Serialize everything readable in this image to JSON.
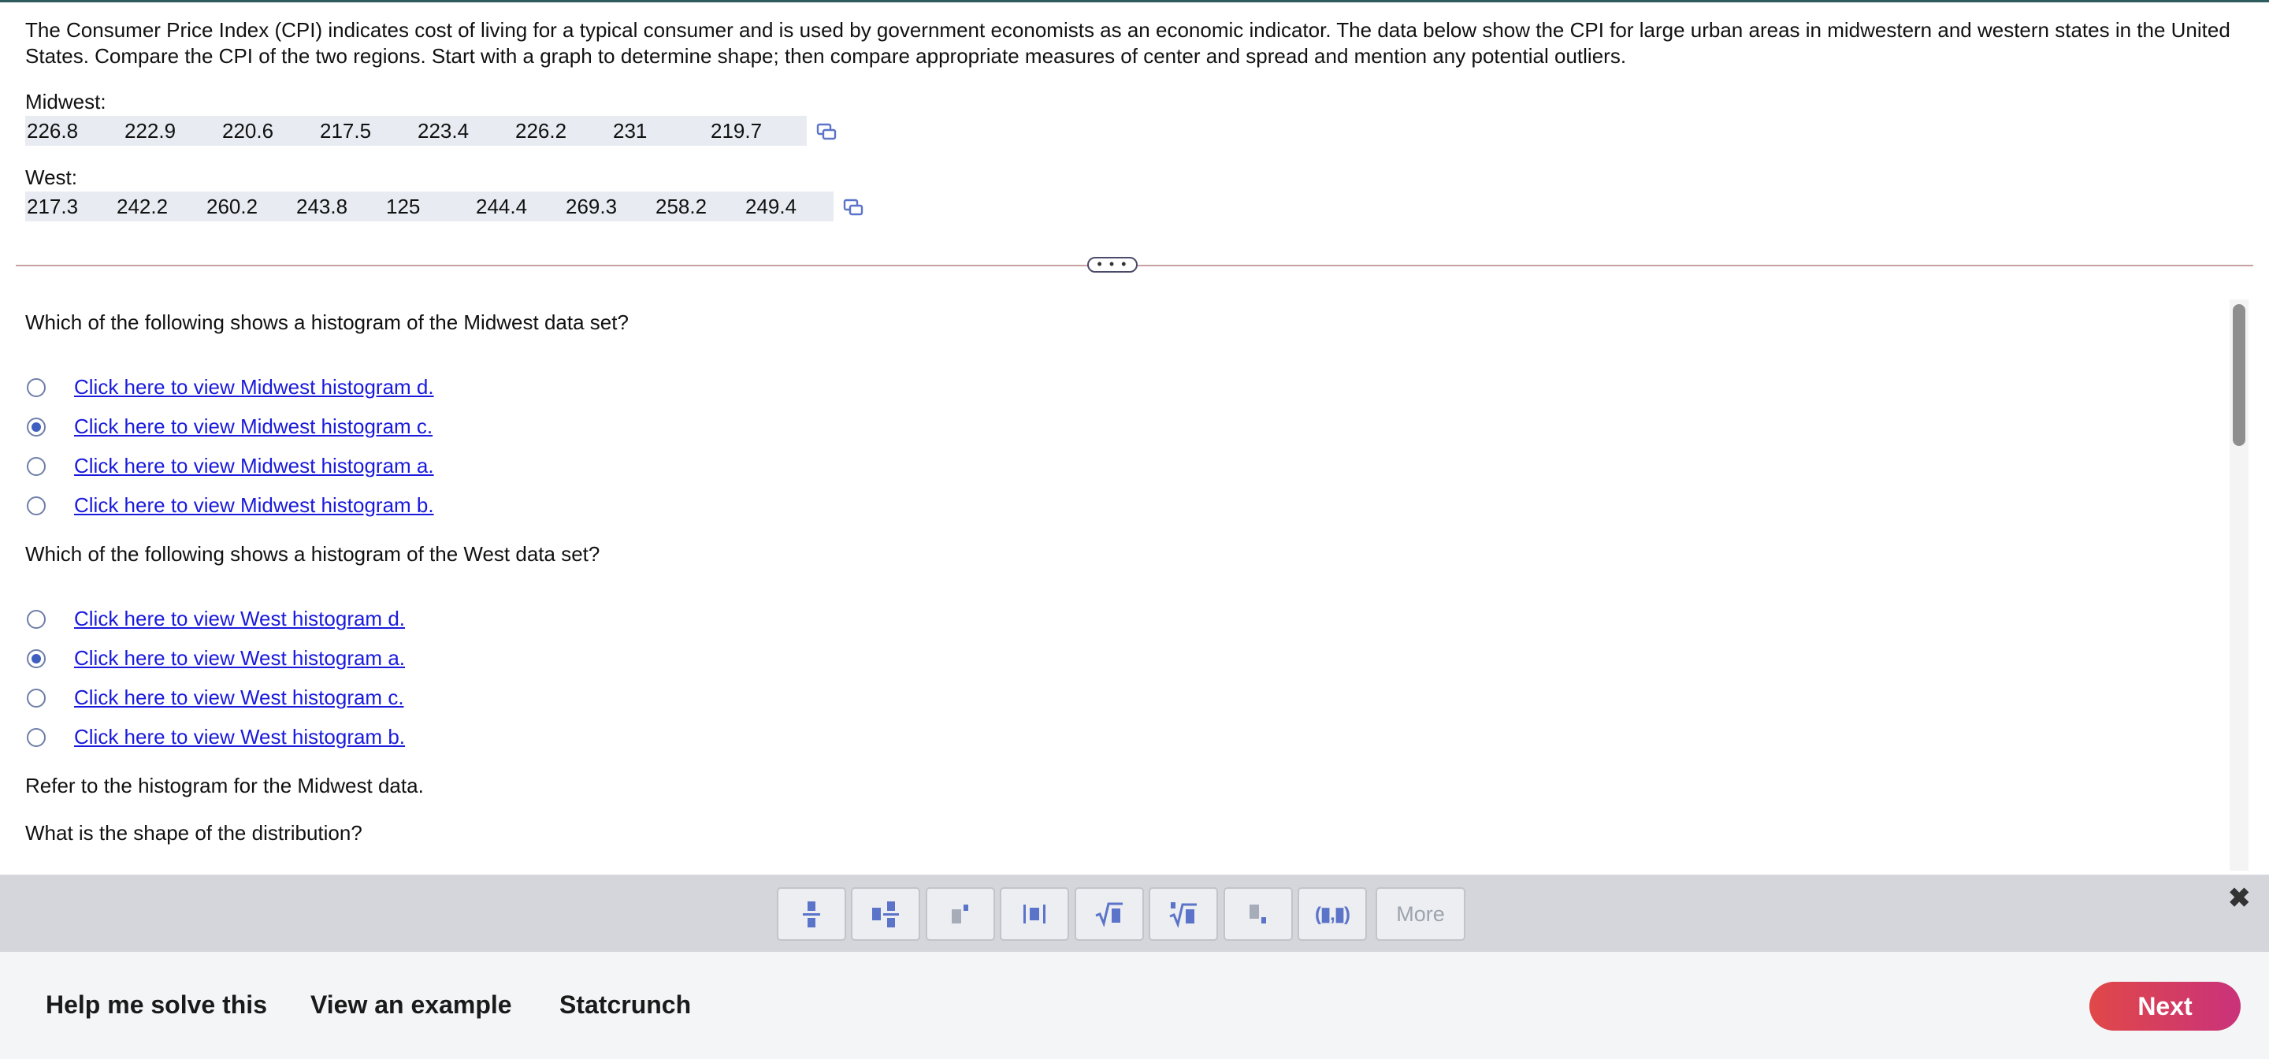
{
  "problem": {
    "text": "The Consumer Price Index (CPI) indicates cost of living for a typical consumer and is used by government economists as an economic indicator. The data below show the CPI for large urban areas in midwestern and western states in the United States. Compare the CPI of the two regions. Start with a graph to determine shape; then compare appropriate measures of center and spread and mention any potential outliers."
  },
  "midwest": {
    "label": "Midwest:",
    "values": [
      "226.8",
      "222.9",
      "220.6",
      "217.5",
      "223.4",
      "226.2",
      "231",
      "219.7"
    ]
  },
  "west": {
    "label": "West:",
    "values": [
      "217.3",
      "242.2",
      "260.2",
      "243.8",
      "125",
      "244.4",
      "269.3",
      "258.2",
      "249.4"
    ]
  },
  "divider": {
    "ellipsis": "• • •"
  },
  "questions": {
    "q1": {
      "prompt": "Which of the following shows a histogram of the Midwest data set?",
      "options": [
        {
          "text": "Click here to view Midwest histogram d.",
          "selected": false
        },
        {
          "text": "Click here to view Midwest histogram c.",
          "selected": true
        },
        {
          "text": "Click here to view Midwest histogram a.",
          "selected": false
        },
        {
          "text": "Click here to view Midwest histogram b.",
          "selected": false
        }
      ]
    },
    "q2": {
      "prompt": "Which of the following shows a histogram of the West data set?",
      "options": [
        {
          "text": "Click here to view West histogram d.",
          "selected": false
        },
        {
          "text": "Click here to view West histogram a.",
          "selected": true
        },
        {
          "text": "Click here to view West histogram c.",
          "selected": false
        },
        {
          "text": "Click here to view West histogram b.",
          "selected": false
        }
      ]
    },
    "q3_intro": "Refer to the histogram for the Midwest data.",
    "q3_prompt": "What is the shape of the distribution?"
  },
  "toolbar": {
    "buttons": [
      "fraction-icon",
      "mixed-number-icon",
      "exponent-icon",
      "absolute-value-icon",
      "square-root-icon",
      "nth-root-icon",
      "subscript-icon",
      "ordered-pair-icon"
    ],
    "ordered_pair_label": "(▮,▮)",
    "more_label": "More",
    "close_label": "✖"
  },
  "footer": {
    "help_label": "Help me solve this",
    "example_label": "View an example",
    "statcrunch_label": "Statcrunch",
    "next_label": "Next"
  },
  "colors": {
    "link": "#1a1adc",
    "radio_selected": "#3e5fbf",
    "next_button_start": "#e04848",
    "next_button_end": "#c9327a",
    "toolbar_icon": "#5b74c9"
  }
}
